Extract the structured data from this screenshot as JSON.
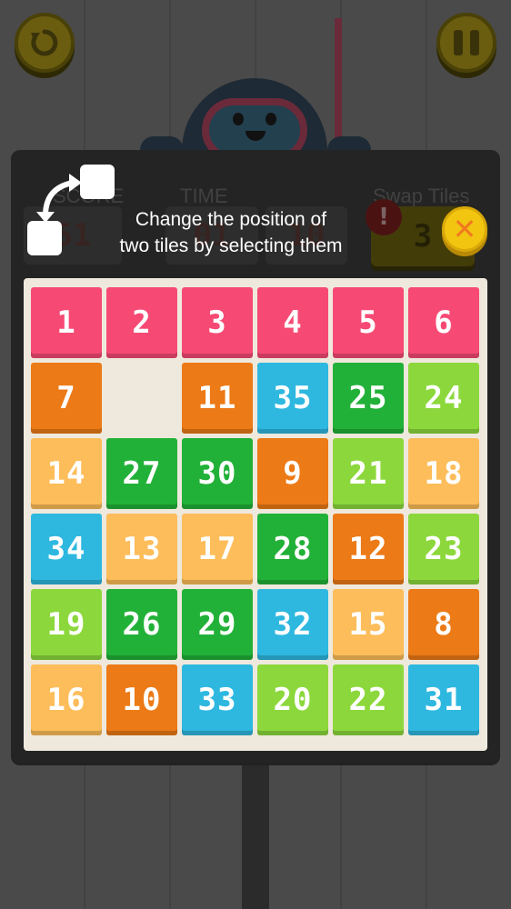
{
  "hud": {
    "score_label": "SCORE",
    "time_label": "TIME",
    "swap_label": "Swap Tiles",
    "score_value": "51",
    "time_minutes": "01",
    "time_seconds": "10",
    "swap_count": "3",
    "alert_mark": "!"
  },
  "tip": {
    "text_line1": "Change the position of",
    "text_line2": "two tiles by selecting them",
    "close_glyph": "✕"
  },
  "colors": {
    "pink": "#f64a74",
    "orange": "#ec7a16",
    "blue": "#2eb8e0",
    "dark_green": "#22b138",
    "light_green": "#8cd83c",
    "yellow": "#fdbd5a",
    "close_button": "#f2c511"
  },
  "icons": {
    "restart": "restart-icon",
    "pause": "pause-icon",
    "swap": "swap-tiles-icon",
    "close": "close-icon",
    "alert": "alert-icon"
  },
  "board": {
    "tiles": [
      {
        "n": "1",
        "c": "pink"
      },
      {
        "n": "2",
        "c": "pink"
      },
      {
        "n": "3",
        "c": "pink"
      },
      {
        "n": "4",
        "c": "pink"
      },
      {
        "n": "5",
        "c": "pink"
      },
      {
        "n": "6",
        "c": "pink"
      },
      {
        "n": "7",
        "c": "orange"
      },
      {
        "n": "",
        "c": "empty"
      },
      {
        "n": "11",
        "c": "orange"
      },
      {
        "n": "35",
        "c": "blue"
      },
      {
        "n": "25",
        "c": "dgreen"
      },
      {
        "n": "24",
        "c": "lgreen"
      },
      {
        "n": "14",
        "c": "yellow"
      },
      {
        "n": "27",
        "c": "dgreen"
      },
      {
        "n": "30",
        "c": "dgreen"
      },
      {
        "n": "9",
        "c": "orange"
      },
      {
        "n": "21",
        "c": "lgreen"
      },
      {
        "n": "18",
        "c": "yellow"
      },
      {
        "n": "34",
        "c": "blue"
      },
      {
        "n": "13",
        "c": "yellow"
      },
      {
        "n": "17",
        "c": "yellow"
      },
      {
        "n": "28",
        "c": "dgreen"
      },
      {
        "n": "12",
        "c": "orange"
      },
      {
        "n": "23",
        "c": "lgreen"
      },
      {
        "n": "19",
        "c": "lgreen"
      },
      {
        "n": "26",
        "c": "dgreen"
      },
      {
        "n": "29",
        "c": "dgreen"
      },
      {
        "n": "32",
        "c": "blue"
      },
      {
        "n": "15",
        "c": "yellow"
      },
      {
        "n": "8",
        "c": "orange"
      },
      {
        "n": "16",
        "c": "yellow"
      },
      {
        "n": "10",
        "c": "orange"
      },
      {
        "n": "33",
        "c": "blue"
      },
      {
        "n": "20",
        "c": "lgreen"
      },
      {
        "n": "22",
        "c": "lgreen"
      },
      {
        "n": "31",
        "c": "blue"
      }
    ]
  }
}
